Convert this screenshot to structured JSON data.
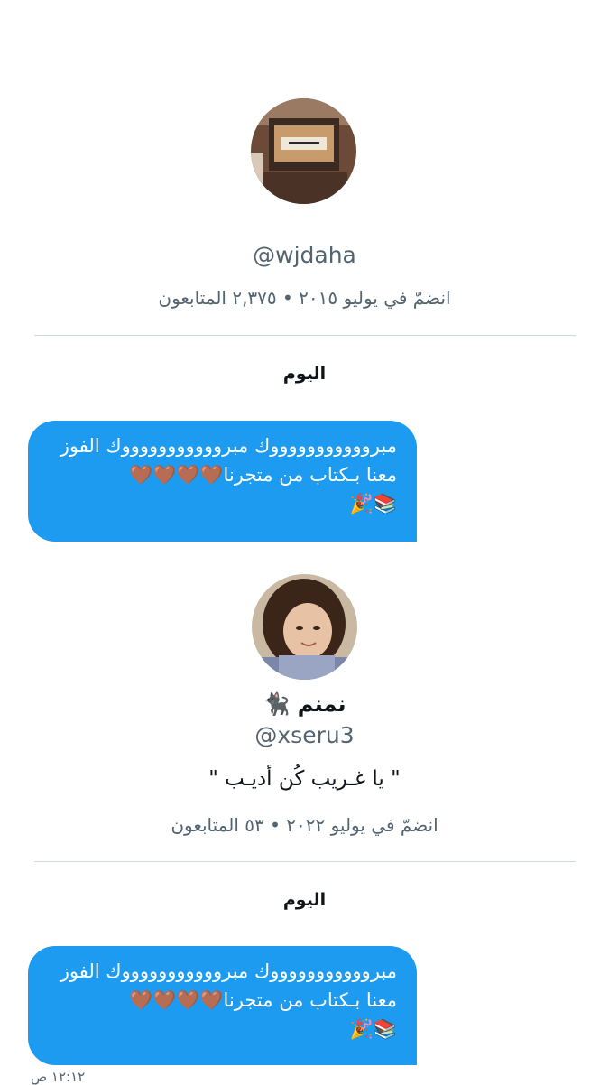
{
  "conversation": [
    {
      "handle": "@wjdaha",
      "meta": "انضمّ في يوليو ٢٠١٥ • ٢,٣٧٥ المتابعون",
      "day_label": "اليوم",
      "message": {
        "line1": "مبروووووووووووك مبروووووووووووك الفوز",
        "line2": "معنا بـكتاب من متجرنا🤎🤎🤎🤎",
        "line3": "📚🎉"
      }
    },
    {
      "display_name": "نمنم 🐈‍⬛",
      "handle": "@xseru3",
      "bio": "\" يا غـريب كُن أديـب \"",
      "meta": "انضمّ في يوليو ٢٠٢٢ • ٥٣ المتابعون",
      "day_label": "اليوم",
      "message": {
        "line1": "مبروووووووووووك مبروووووووووووك الفوز",
        "line2": "معنا بـكتاب من متجرنا🤎🤎🤎🤎",
        "line3": "📚🎉"
      },
      "timestamp": "١٢:١٢ ص"
    }
  ]
}
